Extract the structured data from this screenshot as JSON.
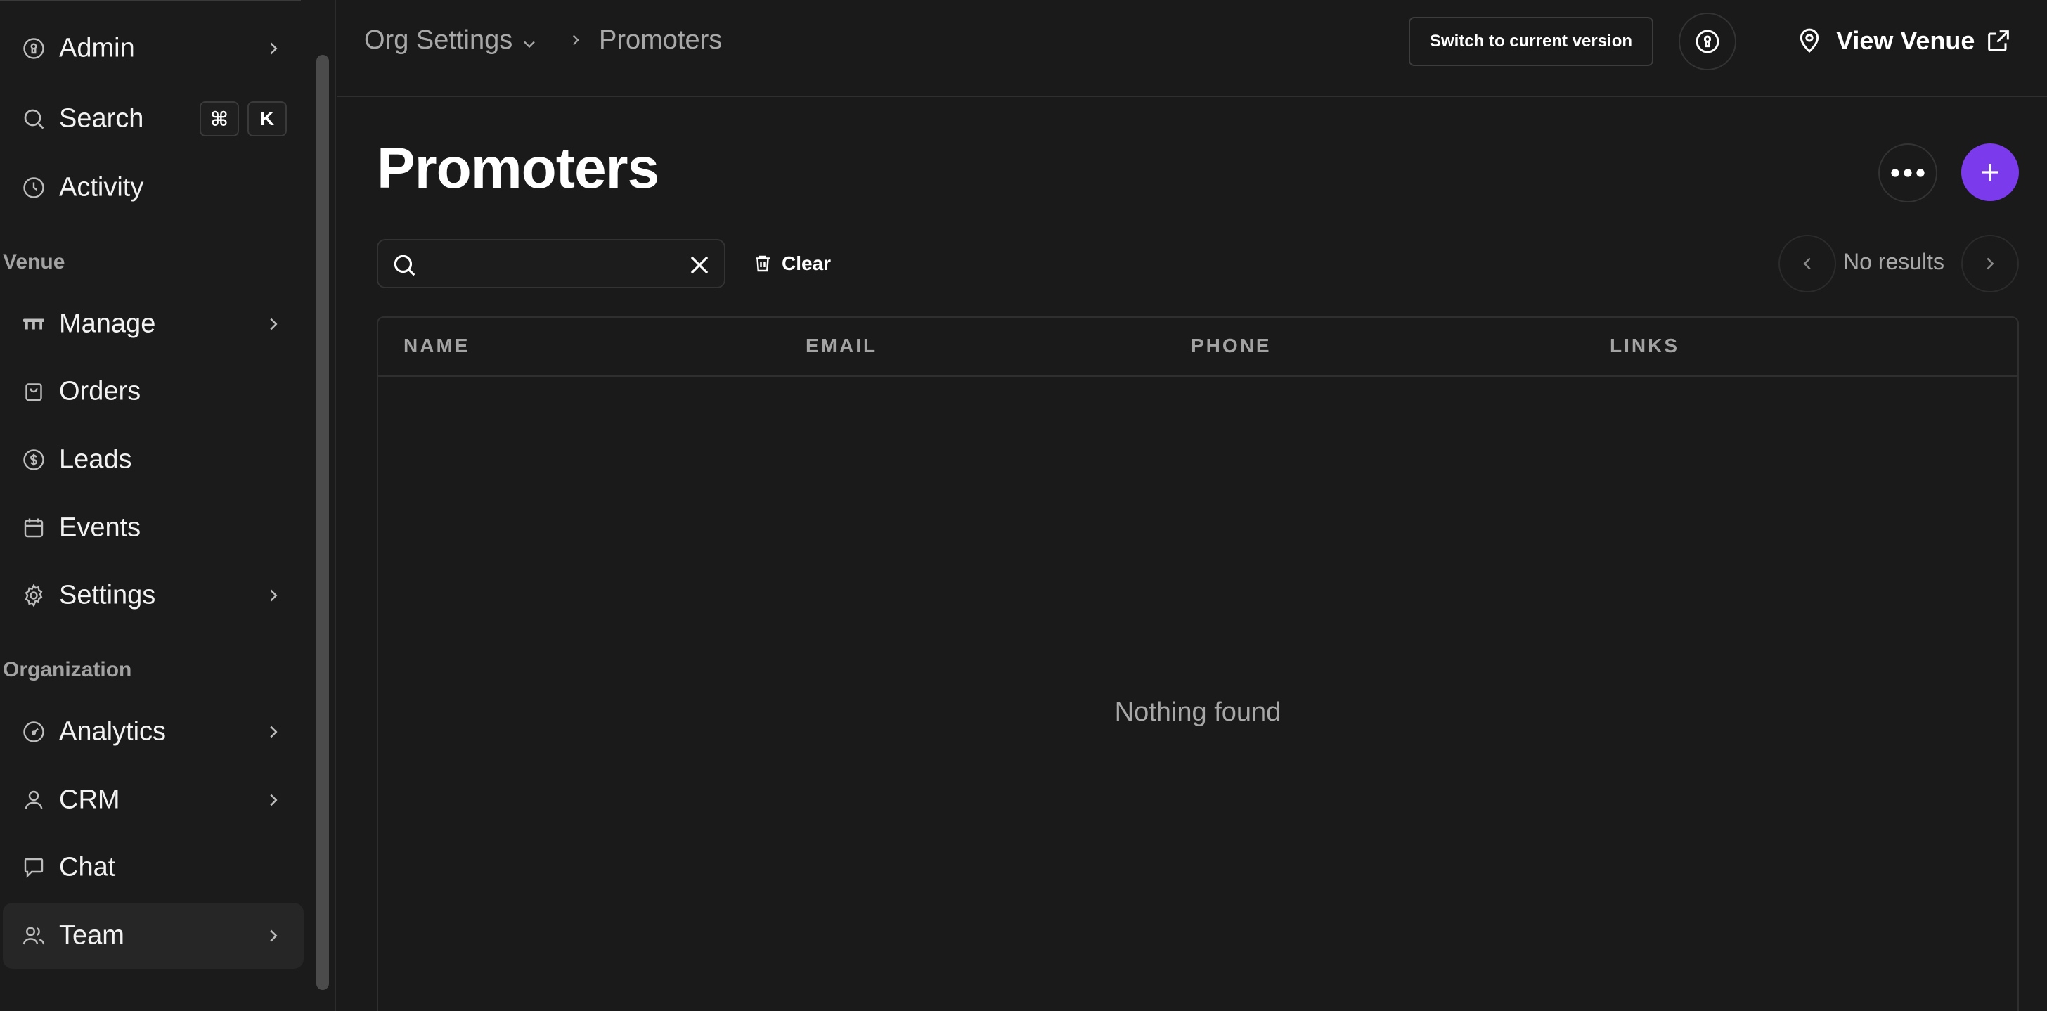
{
  "sidebar": {
    "items": [
      {
        "label": "Admin",
        "icon": "admin-badge-icon"
      },
      {
        "label": "Search",
        "icon": "search-icon",
        "shortcut": [
          "⌘",
          "K"
        ]
      },
      {
        "label": "Activity",
        "icon": "clock-icon"
      },
      {
        "label": "Manage",
        "icon": "table-icon"
      },
      {
        "label": "Orders",
        "icon": "shopping-bag-icon"
      },
      {
        "label": "Leads",
        "icon": "dollar-circle-icon"
      },
      {
        "label": "Events",
        "icon": "calendar-icon"
      },
      {
        "label": "Settings",
        "icon": "gear-icon"
      },
      {
        "label": "Analytics",
        "icon": "gauge-icon"
      },
      {
        "label": "CRM",
        "icon": "user-icon"
      },
      {
        "label": "Chat",
        "icon": "chat-bubble-icon"
      },
      {
        "label": "Team",
        "icon": "users-icon",
        "active": true
      }
    ],
    "sections": {
      "venue": "Venue",
      "organization": "Organization"
    }
  },
  "header": {
    "breadcrumb_parent": "Org Settings",
    "breadcrumb_current": "Promoters",
    "switch_version_label": "Switch to current version",
    "view_venue_label": "View Venue"
  },
  "main": {
    "title": "Promoters",
    "search": {
      "value": "",
      "placeholder": ""
    },
    "clear_label": "Clear",
    "pager_status": "No results",
    "table": {
      "columns": [
        "NAME",
        "EMAIL",
        "PHONE",
        "LINKS"
      ],
      "rows": [],
      "empty_text": "Nothing found"
    }
  },
  "colors": {
    "background": "#1a1a1a",
    "accent": "#7c3aed",
    "muted_text": "#a8a8a8"
  }
}
